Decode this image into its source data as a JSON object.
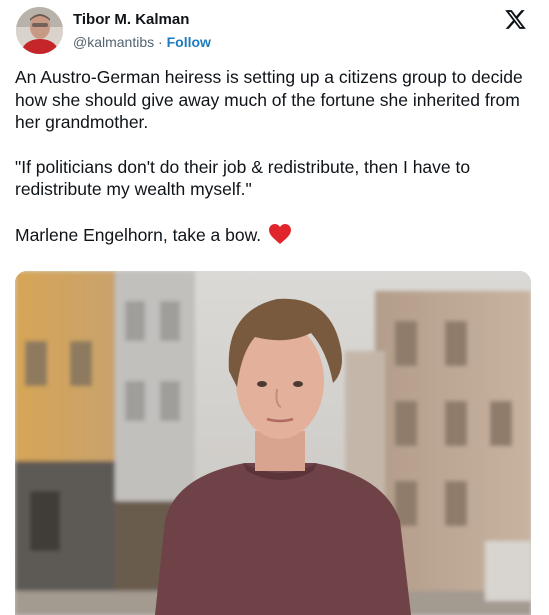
{
  "author": {
    "name": "Tibor M. Kalman",
    "handle": "@kalmantibs",
    "separator": " · ",
    "follow_label": "Follow"
  },
  "platform_icon": "x-logo-icon",
  "tweet": {
    "paragraphs": [
      "An Austro-German heiress is setting up a citizens group to decide how she should give away much of the fortune she inherited from her grandmother.",
      "\"If politicians don't do their job & redistribute, then I have to redistribute my wealth myself.\"",
      "Marlene Engelhorn, take a bow."
    ],
    "emoji": "red-heart-icon"
  },
  "media": {
    "kind": "photo",
    "description_icon": "portrait-photo"
  },
  "colors": {
    "follow": "#1d7bbf",
    "secondary_text": "#536471",
    "heart": "#e0262c"
  }
}
